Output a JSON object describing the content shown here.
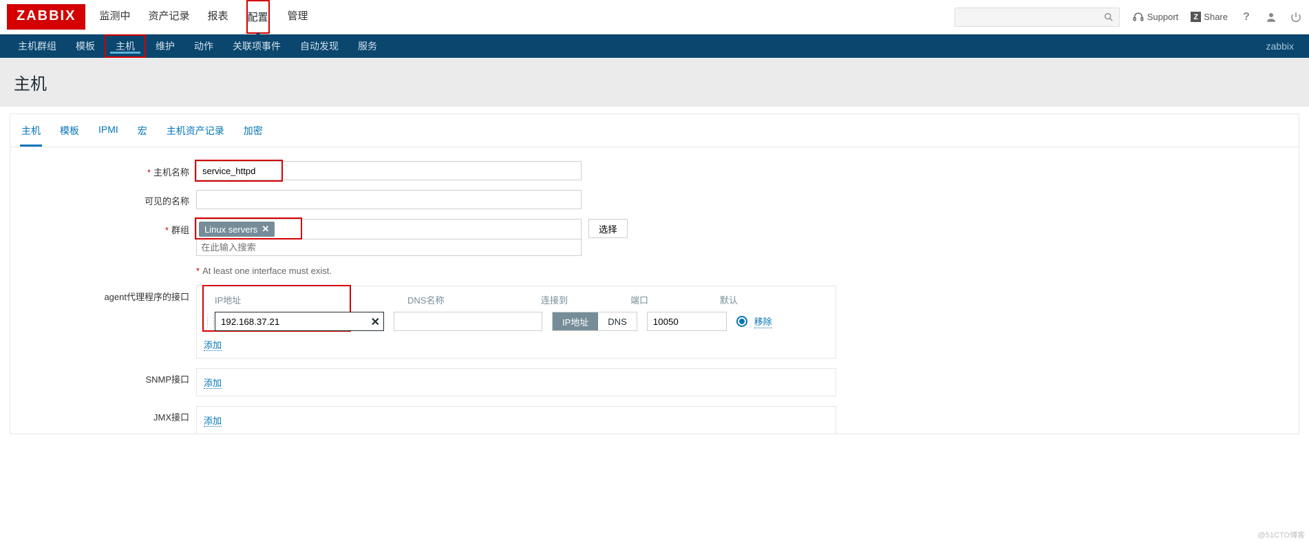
{
  "logo": "ZABBIX",
  "topnav": [
    "监测中",
    "资产记录",
    "报表",
    "配置",
    "管理"
  ],
  "topnav_selected": 3,
  "support": "Support",
  "share": "Share",
  "subnav": [
    "主机群组",
    "模板",
    "主机",
    "维护",
    "动作",
    "关联项事件",
    "自动发现",
    "服务"
  ],
  "subnav_selected": 2,
  "subnav_right": "zabbix",
  "page_title": "主机",
  "tabs": [
    "主机",
    "模板",
    "IPMI",
    "宏",
    "主机资产记录",
    "加密"
  ],
  "tabs_selected": 0,
  "form": {
    "hostname_label": "主机名称",
    "hostname_value": "service_httpd",
    "visible_label": "可见的名称",
    "visible_value": "",
    "groups_label": "群组",
    "group_tag": "Linux servers",
    "groups_placeholder": "在此输入搜索",
    "select_btn": "选择",
    "iface_warn": "At least one interface must exist.",
    "agent_label": "agent代理程序的接口",
    "col_ip": "IP地址",
    "col_dns": "DNS名称",
    "col_conn": "连接到",
    "col_port": "端口",
    "col_def": "默认",
    "ip_value": "192.168.37.21",
    "dns_value": "",
    "conn_ip": "IP地址",
    "conn_dns": "DNS",
    "port_value": "10050",
    "remove": "移除",
    "add": "添加",
    "snmp_label": "SNMP接口",
    "jmx_label": "JMX接口"
  },
  "watermark": "@51CTO博客"
}
